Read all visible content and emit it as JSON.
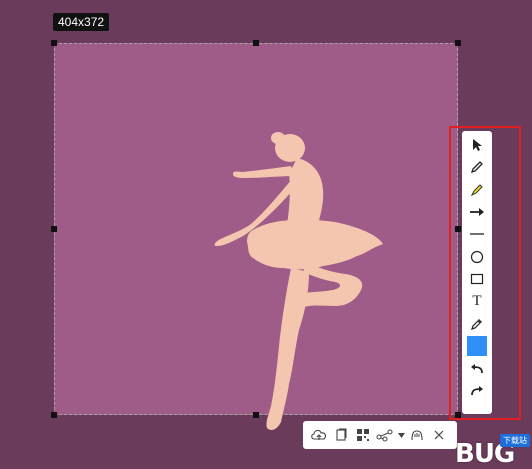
{
  "capture": {
    "size_label": "404x372"
  },
  "colors": {
    "background": "#6b3b5c",
    "selection_fill": "#a05c88",
    "dancer": "#f4c6b0",
    "highlight_border": "#e02020",
    "active_color": "#2f8ef7"
  },
  "side_toolbar": {
    "tools": [
      {
        "name": "select-arrow-icon"
      },
      {
        "name": "pen-icon"
      },
      {
        "name": "highlighter-icon"
      },
      {
        "name": "arrow-icon"
      },
      {
        "name": "line-icon"
      },
      {
        "name": "ellipse-icon"
      },
      {
        "name": "rectangle-icon"
      },
      {
        "name": "text-icon",
        "label": "T"
      },
      {
        "name": "eyedropper-icon"
      },
      {
        "name": "color-swatch"
      },
      {
        "name": "undo-icon"
      },
      {
        "name": "redo-icon"
      }
    ]
  },
  "bottom_toolbar": {
    "tools": [
      {
        "name": "cloud-upload-icon"
      },
      {
        "name": "copy-icon"
      },
      {
        "name": "qr-code-icon"
      },
      {
        "name": "share-icon"
      },
      {
        "name": "chevron-down-icon"
      },
      {
        "name": "pin-icon"
      },
      {
        "name": "close-icon"
      }
    ]
  },
  "watermark": {
    "text": "BUG",
    "tag": "下载站"
  }
}
